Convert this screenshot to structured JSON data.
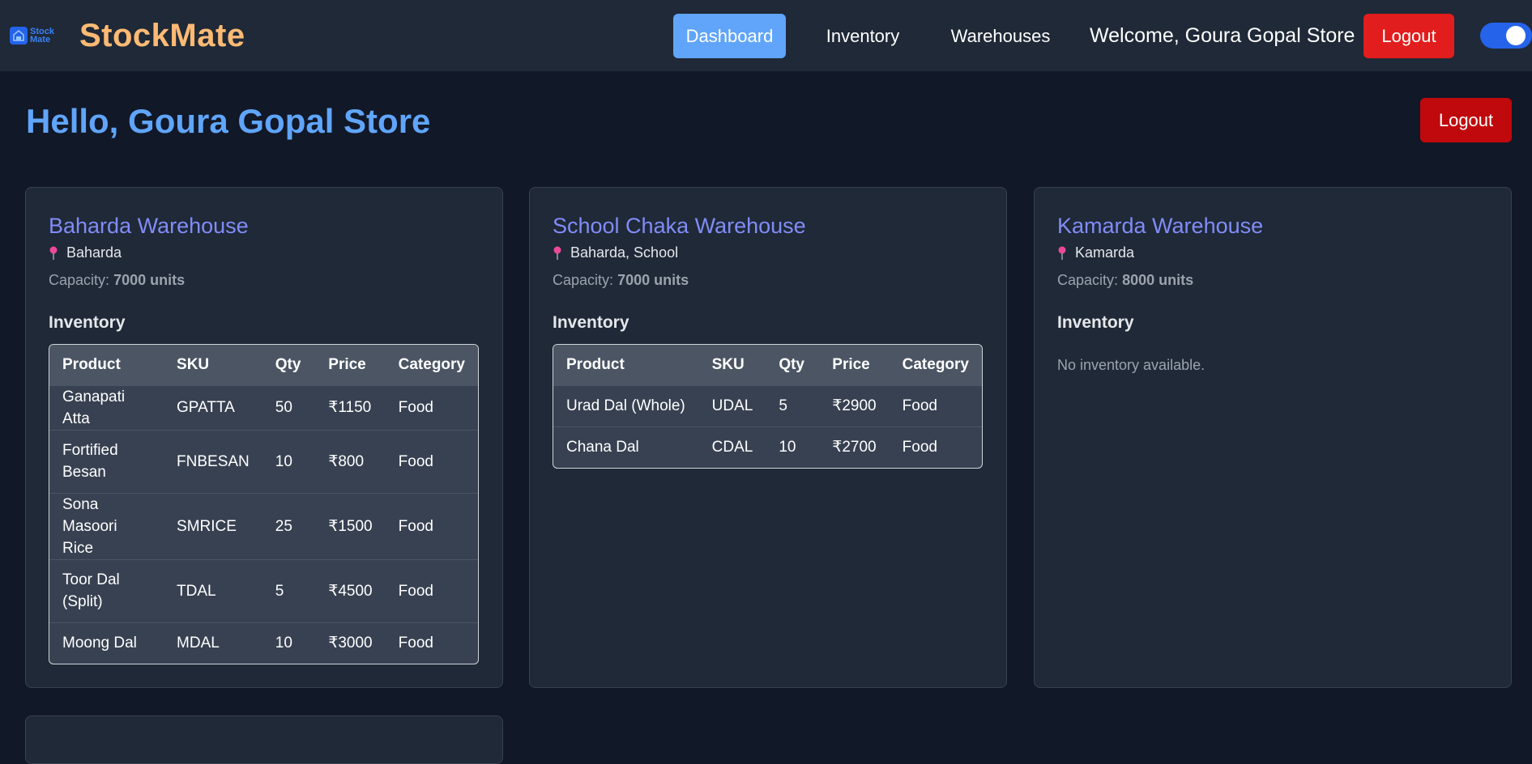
{
  "header": {
    "logo_text_line1": "Stock",
    "logo_text_line2": "Mate",
    "brand": "StockMate",
    "nav": {
      "dashboard": "Dashboard",
      "inventory": "Inventory",
      "warehouses": "Warehouses"
    },
    "welcome": "Welcome, Goura Gopal Store",
    "logout": "Logout",
    "theme_toggle_on": true
  },
  "main": {
    "greeting": "Hello, Goura Gopal Store",
    "logout": "Logout",
    "inventory_heading": "Inventory",
    "capacity_label": "Capacity:",
    "columns": [
      "Product",
      "SKU",
      "Qty",
      "Price",
      "Category"
    ],
    "warehouses": [
      {
        "name": "Baharda Warehouse",
        "location": "Baharda",
        "capacity": "7000 units",
        "inventory": [
          [
            "Ganapati Atta",
            "GPATTA",
            "50",
            "₹1150",
            "Food"
          ],
          [
            "Fortified Besan",
            "FNBESAN",
            "10",
            "₹800",
            "Food"
          ],
          [
            "Sona Masoori Rice",
            "SMRICE",
            "25",
            "₹1500",
            "Food"
          ],
          [
            "Toor Dal (Split)",
            "TDAL",
            "5",
            "₹4500",
            "Food"
          ],
          [
            "Moong Dal",
            "MDAL",
            "10",
            "₹3000",
            "Food"
          ]
        ]
      },
      {
        "name": "School Chaka Warehouse",
        "location": "Baharda, School",
        "capacity": "7000 units",
        "inventory": [
          [
            "Urad Dal (Whole)",
            "UDAL",
            "5",
            "₹2900",
            "Food"
          ],
          [
            "Chana Dal",
            "CDAL",
            "10",
            "₹2700",
            "Food"
          ]
        ]
      },
      {
        "name": "Kamarda Warehouse",
        "location": "Kamarda",
        "capacity": "8000 units",
        "empty_message": "No inventory available."
      }
    ]
  },
  "colors": {
    "background": "#111827",
    "header": "#1f2937",
    "brand": "#fdba74",
    "accent": "#60a5fa",
    "warehouse_name": "#818cf8",
    "logout": "#e11d1d"
  }
}
